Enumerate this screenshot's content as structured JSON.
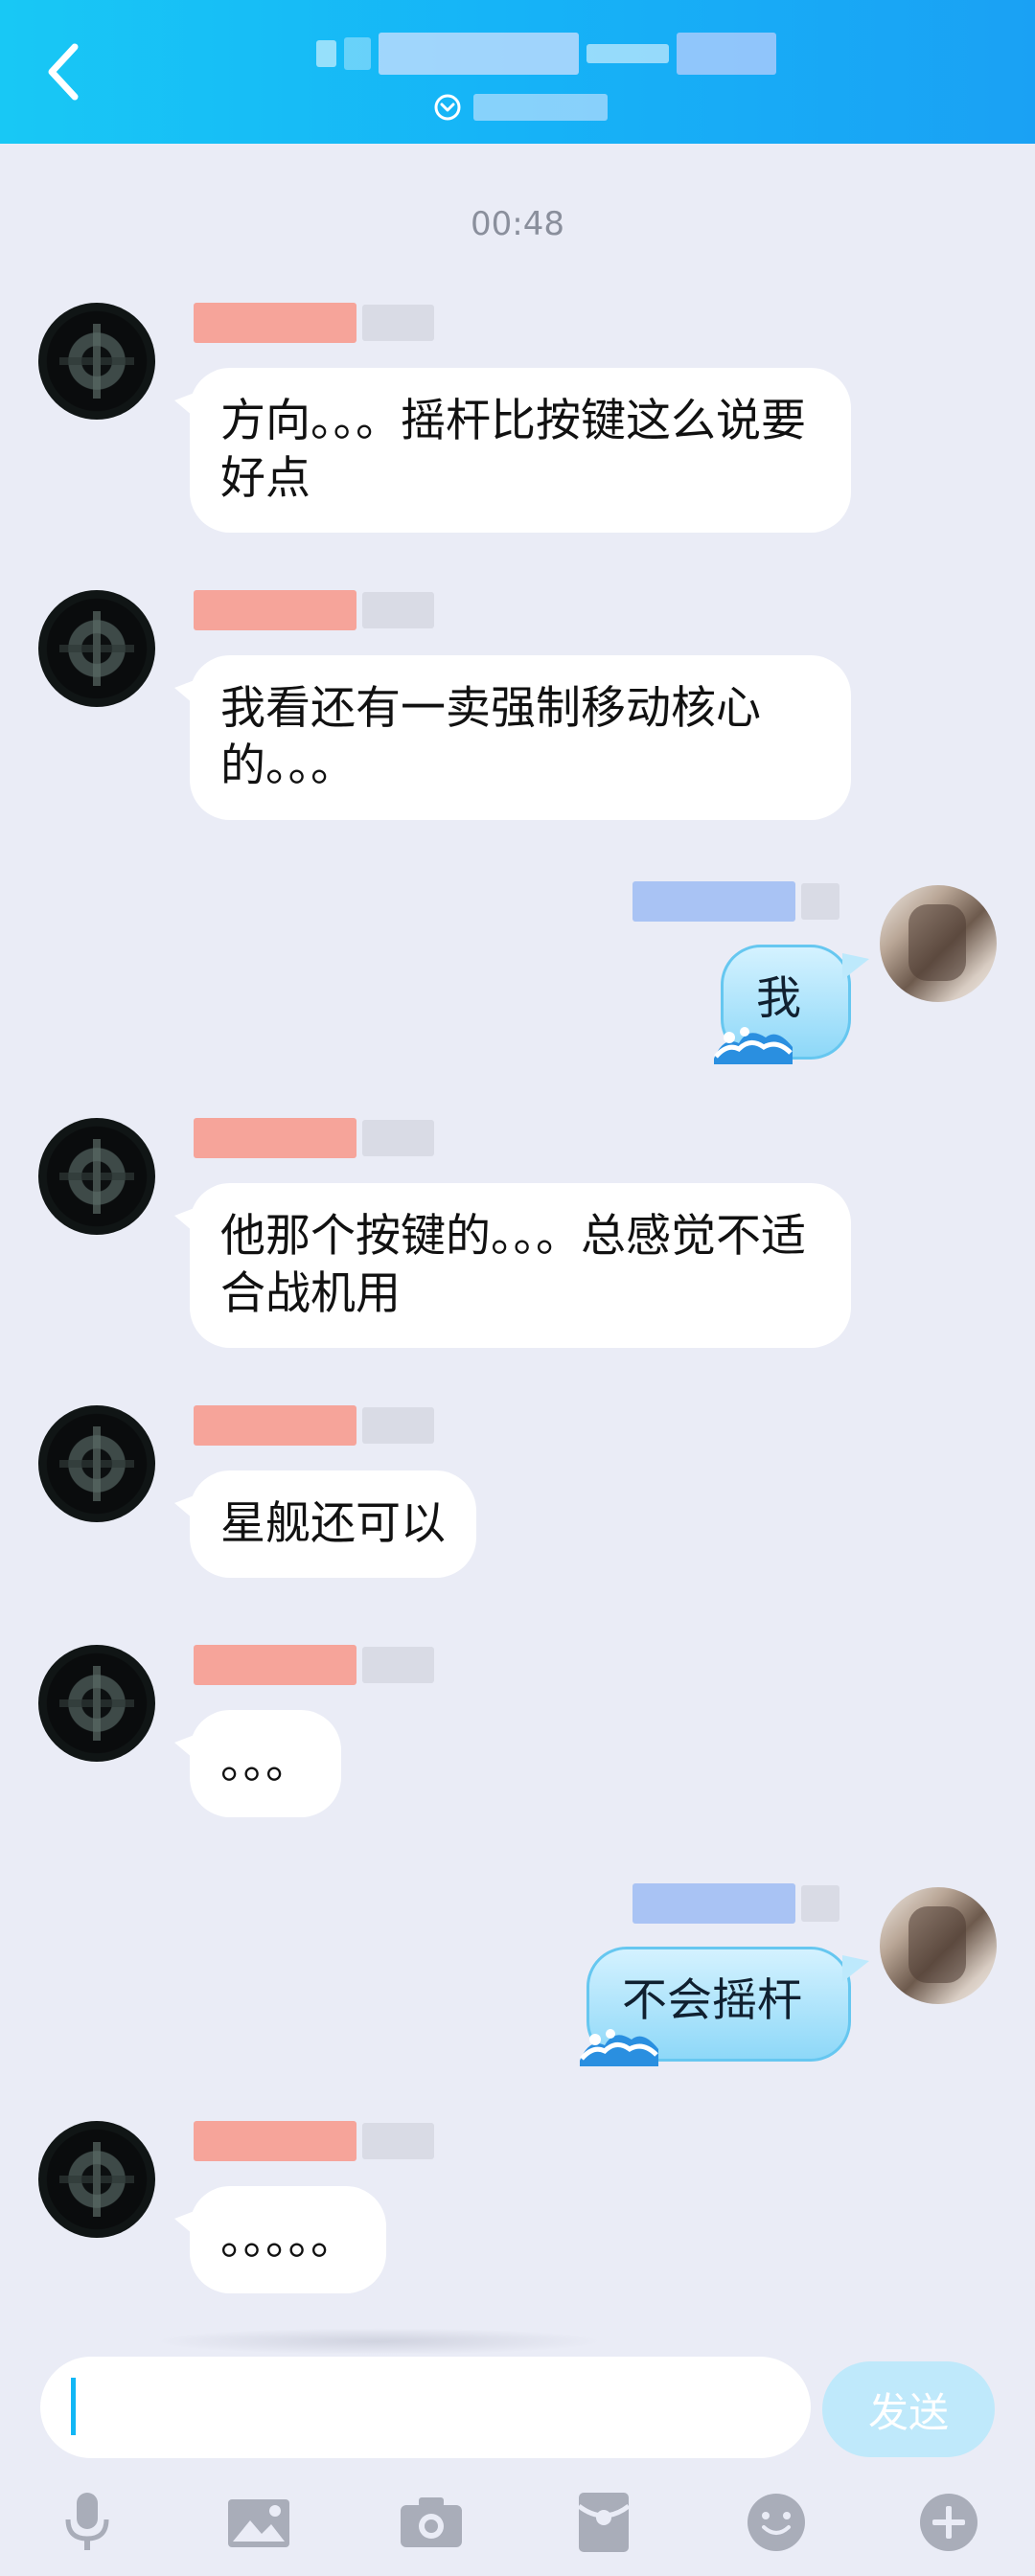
{
  "header": {
    "back_icon": "chevron-left-icon"
  },
  "timestamp": "00:48",
  "messages": [
    {
      "side": "left",
      "text": "方向。。。摇杆比按键这么说要好点"
    },
    {
      "side": "left",
      "text": "我看还有一卖强制移动核心的。。。"
    },
    {
      "side": "right",
      "text": "我"
    },
    {
      "side": "left",
      "text": "他那个按键的。。。总感觉不适合战机用"
    },
    {
      "side": "left",
      "text": "星舰还可以"
    },
    {
      "side": "left",
      "text": "。。。"
    },
    {
      "side": "right",
      "text": "不会摇杆"
    },
    {
      "side": "left",
      "text": "。。。。。"
    }
  ],
  "composer": {
    "send_label": "发送"
  },
  "toolbar": {
    "icons": [
      "microphone-icon",
      "image-icon",
      "camera-icon",
      "red-packet-icon",
      "emoji-icon",
      "plus-icon"
    ]
  },
  "colors": {
    "header_start": "#18c8f5",
    "header_end": "#1aa1f4",
    "background": "#eaecf6",
    "send_disabled": "#bfe9fb",
    "my_bubble": "#8ed8f8"
  }
}
